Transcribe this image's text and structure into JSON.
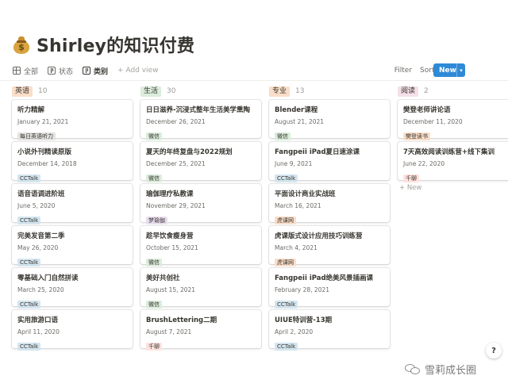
{
  "page": {
    "icon": "money-bag-icon",
    "title": "Shirley的知识付费"
  },
  "views": [
    {
      "label": "全部",
      "icon": "table-icon"
    },
    {
      "label": "状态",
      "icon": "board-icon"
    },
    {
      "label": "类别",
      "icon": "board-icon",
      "active": true
    }
  ],
  "add_view_label": "+ Add view",
  "toolbar": {
    "filter_label": "Filter",
    "sort_label": "Sort",
    "more_label": "···",
    "new_label": "New",
    "new_caret": "▾"
  },
  "colors": {
    "accent": "#2e8ad6",
    "tag_orange": "#fadec9",
    "tag_green": "#dbeddb",
    "tag_gray": "#e3e2e0",
    "tag_blue": "#d3e5ef",
    "tag_purple": "#e8deee",
    "tag_pink": "#f5e0e9",
    "tag_red": "#ffe2dd",
    "tag_brown": "#eee0da"
  },
  "groups": [
    {
      "name": "英语",
      "count": "10",
      "color": "#fadec9",
      "cards": [
        {
          "title": "听力精解",
          "date": "January 21, 2021",
          "tag": "每日英语听力",
          "tag_color": "#e3e2e0"
        },
        {
          "title": "小说外刊精读原版",
          "date": "December 14, 2018",
          "tag": "CCTalk",
          "tag_color": "#d3e5ef"
        },
        {
          "title": "语音语调进阶班",
          "date": "June 5, 2020",
          "tag": "CCTalk",
          "tag_color": "#d3e5ef"
        },
        {
          "title": "完美发音第二季",
          "date": "May 26, 2020",
          "tag": "CCTalk",
          "tag_color": "#d3e5ef"
        },
        {
          "title": "零基础入门自然拼读",
          "date": "March 25, 2020",
          "tag": "CCTalk",
          "tag_color": "#d3e5ef"
        },
        {
          "title": "实用旅游口语",
          "date": "April 11, 2020",
          "tag": "CCTalk",
          "tag_color": "#d3e5ef"
        }
      ]
    },
    {
      "name": "生活",
      "count": "30",
      "color": "#dbeddb",
      "cards": [
        {
          "title": "日日滋养-沉浸式整年生活美学熏陶",
          "date": "December 26, 2021",
          "tag": "微信",
          "tag_color": "#dbeddb"
        },
        {
          "title": "夏天的年终复盘与2022规划",
          "date": "December 25, 2021",
          "tag": "微信",
          "tag_color": "#dbeddb"
        },
        {
          "title": "瑜伽理疗私教课",
          "date": "November 29, 2021",
          "tag": "梦瑜伽",
          "tag_color": "#e8deee"
        },
        {
          "title": "趁早饮食瘦身营",
          "date": "October 15, 2021",
          "tag": "微信",
          "tag_color": "#dbeddb"
        },
        {
          "title": "美好共创社",
          "date": "August 15, 2021",
          "tag": "微信",
          "tag_color": "#dbeddb"
        },
        {
          "title": "BrushLettering二期",
          "date": "August 7, 2021",
          "tag": "千聊",
          "tag_color": "#ffe2dd"
        }
      ]
    },
    {
      "name": "专业",
      "count": "13",
      "color": "#fadec9",
      "cards": [
        {
          "title": "Blender课程",
          "date": "August 21, 2021",
          "tag": "微信",
          "tag_color": "#dbeddb"
        },
        {
          "title": "Fangpeii iPad夏日速涂课",
          "date": "June 9, 2021",
          "tag": "CCTalk",
          "tag_color": "#d3e5ef"
        },
        {
          "title": "平面设计商业实战班",
          "date": "March 16, 2021",
          "tag": "虎课网",
          "tag_color": "#fadec9"
        },
        {
          "title": "虎课版式设计应用技巧训练营",
          "date": "March 4, 2021",
          "tag": "虎课网",
          "tag_color": "#fadec9"
        },
        {
          "title": "Fangpeii iPad绝美风景插画课",
          "date": "February 28, 2021",
          "tag": "CCTalk",
          "tag_color": "#d3e5ef"
        },
        {
          "title": "UIUE特训营-13期",
          "date": "April 2, 2020",
          "tag": "CCTalk",
          "tag_color": "#d3e5ef"
        }
      ]
    },
    {
      "name": "阅读",
      "count": "2",
      "color": "#f5e0e9",
      "cards": [
        {
          "title": "樊登老师讲论语",
          "date": "December 11, 2020",
          "tag": "樊登读书",
          "tag_color": "#fadec9"
        },
        {
          "title": "7天高效阅读训练营+线下集训",
          "date": "June 22, 2020",
          "tag": "千聊",
          "tag_color": "#ffe2dd"
        }
      ],
      "add_label": "+ New"
    }
  ],
  "help_label": "?",
  "watermark": "雪莉成长圈"
}
